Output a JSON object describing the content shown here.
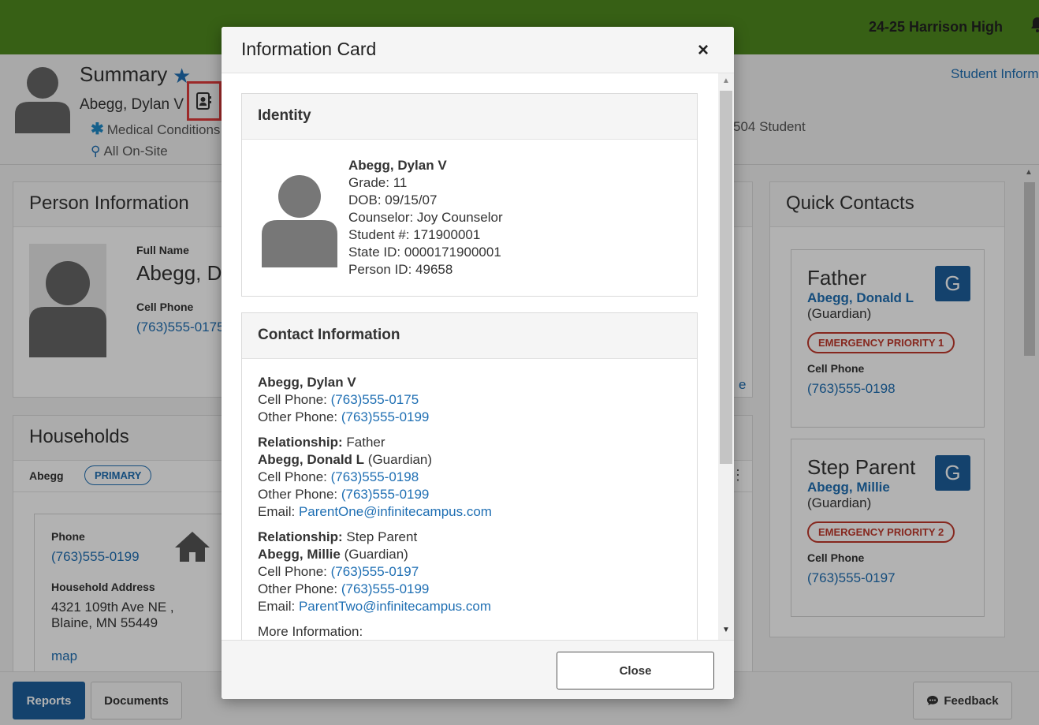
{
  "topbar": {
    "school": "24-25 Harrison High"
  },
  "summary": {
    "title": "Summary",
    "name": "Abegg, Dylan V",
    "medical": "Medical Conditions",
    "onsite": "All On-Site",
    "s504": "504 Student",
    "student_info_link": "Student Information"
  },
  "person_panel": {
    "title": "Person Information",
    "full_name_label": "Full Name",
    "full_name": "Abegg, Dylan V",
    "cell_label": "Cell Phone",
    "cell": "(763)555-0175",
    "more": "e"
  },
  "households": {
    "title": "Households",
    "tab_name": "Abegg",
    "tab_badge": "PRIMARY",
    "phone_label": "Phone",
    "phone": "(763)555-0199",
    "address_label": "Household Address",
    "address": "4321 109th Ave NE , Blaine, MN 55449",
    "map": "map"
  },
  "quick_contacts": {
    "title": "Quick Contacts",
    "contacts": [
      {
        "relationship": "Father",
        "name": "Abegg, Donald L",
        "role": "(Guardian)",
        "badge": "G",
        "priority": "EMERGENCY PRIORITY 1",
        "cell_label": "Cell Phone",
        "cell": "(763)555-0198"
      },
      {
        "relationship": "Step Parent",
        "name": "Abegg, Millie",
        "role": "(Guardian)",
        "badge": "G",
        "priority": "EMERGENCY PRIORITY 2",
        "cell_label": "Cell Phone",
        "cell": "(763)555-0197"
      }
    ]
  },
  "bottom": {
    "reports": "Reports",
    "documents": "Documents",
    "feedback": "Feedback"
  },
  "modal": {
    "title": "Information Card",
    "close_x": "×",
    "identity": {
      "title": "Identity",
      "name": "Abegg, Dylan V",
      "grade": "Grade: 11",
      "dob": "DOB: 09/15/07",
      "counselor": "Counselor: Joy Counselor",
      "student_num": "Student #: 171900001",
      "state_id": "State ID: 0000171900001",
      "person_id": "Person ID: 49658"
    },
    "contact": {
      "title": "Contact Information",
      "student": {
        "name": "Abegg, Dylan V",
        "cell_label": "Cell Phone:",
        "cell": "(763)555-0175",
        "other_label": "Other Phone:",
        "other": "(763)555-0199"
      },
      "guardians": [
        {
          "rel_label": "Relationship:",
          "rel": "Father",
          "name": "Abegg, Donald L",
          "role": "(Guardian)",
          "cell_label": "Cell Phone:",
          "cell": "(763)555-0198",
          "other_label": "Other Phone:",
          "other": "(763)555-0199",
          "email_label": "Email:",
          "email": "ParentOne@infinitecampus.com"
        },
        {
          "rel_label": "Relationship:",
          "rel": "Step Parent",
          "name": "Abegg, Millie",
          "role": "(Guardian)",
          "cell_label": "Cell Phone:",
          "cell": "(763)555-0197",
          "other_label": "Other Phone:",
          "other": "(763)555-0199",
          "email_label": "Email:",
          "email": "ParentTwo@infinitecampus.com"
        }
      ],
      "more_info": "More Information:"
    },
    "close_button": "Close"
  },
  "colors": {
    "topbar": "#4f8a1f",
    "link": "#1f6fb3",
    "primary_button": "#1d5f9c",
    "emergency": "#c0392b",
    "highlight": "#e03c3c"
  }
}
